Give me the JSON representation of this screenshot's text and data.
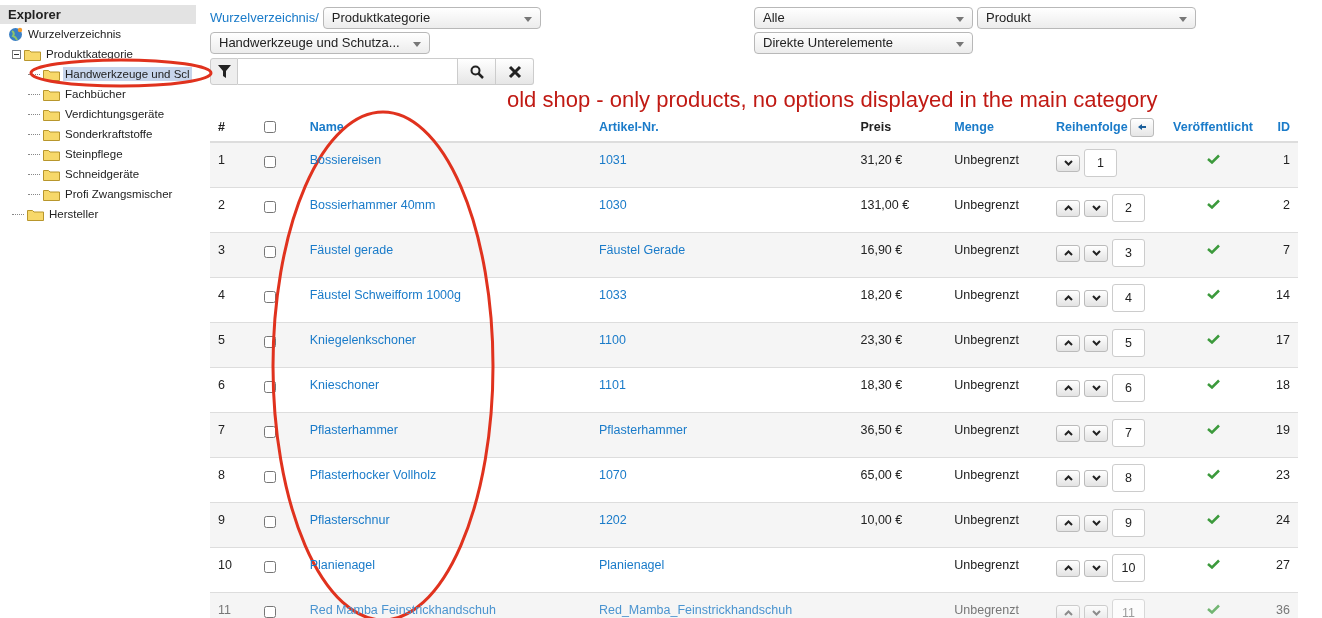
{
  "sidebar": {
    "title": "Explorer",
    "root": {
      "label": "Wurzelverzeichnis",
      "children": [
        {
          "label": "Produktkategorie",
          "expanded": true,
          "selected": false,
          "children": [
            {
              "label": "Handwerkzeuge und Scl",
              "selected": true
            },
            {
              "label": "Fachbücher",
              "selected": false
            },
            {
              "label": "Verdichtungsgeräte",
              "selected": false
            },
            {
              "label": "Sonderkraftstoffe",
              "selected": false
            },
            {
              "label": "Steinpflege",
              "selected": false
            },
            {
              "label": "Schneidgeräte",
              "selected": false
            },
            {
              "label": "Profi Zwangsmischer",
              "selected": false
            }
          ]
        },
        {
          "label": "Hersteller",
          "selected": false
        }
      ]
    }
  },
  "breadcrumb": "Wurzelverzeichnis/",
  "selects_left": [
    "Produktkategorie",
    "Handwerkzeuge und Schutza..."
  ],
  "selects_right": [
    "Alle",
    "Produkt",
    "Direkte Unterelemente"
  ],
  "annotation": "old shop - only products, no options displayed in the main category",
  "table": {
    "columns": [
      {
        "label": "#",
        "kind": "text"
      },
      {
        "kind": "checkbox",
        "checked": false
      },
      {
        "label": "Name",
        "kind": "link"
      },
      {
        "label": "Artikel-Nr.",
        "kind": "link"
      },
      {
        "label": "Preis",
        "kind": "text"
      },
      {
        "label": "Menge",
        "kind": "link"
      },
      {
        "label": "Reihenfolge",
        "kind": "link"
      },
      {
        "label": "Veröffentlicht",
        "kind": "link"
      },
      {
        "label": "ID",
        "kind": "link"
      }
    ],
    "rows": [
      {
        "num": "1",
        "name": "Bossiereisen",
        "sku": "1031",
        "price": "31,20 €",
        "stock": "Unbegrenzt",
        "up": false,
        "down": true,
        "order": "1",
        "published": true,
        "id": "1",
        "faded": false
      },
      {
        "num": "2",
        "name": "Bossierhammer 40mm",
        "sku": "1030",
        "price": "131,00 €",
        "stock": "Unbegrenzt",
        "up": true,
        "down": true,
        "order": "2",
        "published": true,
        "id": "2",
        "faded": false
      },
      {
        "num": "3",
        "name": "Fäustel gerade",
        "sku": "Fäustel Gerade",
        "price": "16,90 €",
        "stock": "Unbegrenzt",
        "up": true,
        "down": true,
        "order": "3",
        "published": true,
        "id": "7",
        "faded": false
      },
      {
        "num": "4",
        "name": "Fäustel Schweifform 1000g",
        "sku": "1033",
        "price": "18,20 €",
        "stock": "Unbegrenzt",
        "up": true,
        "down": true,
        "order": "4",
        "published": true,
        "id": "14",
        "faded": false
      },
      {
        "num": "5",
        "name": "Kniegelenkschoner",
        "sku": "1100",
        "price": "23,30 €",
        "stock": "Unbegrenzt",
        "up": true,
        "down": true,
        "order": "5",
        "published": true,
        "id": "17",
        "faded": false
      },
      {
        "num": "6",
        "name": "Knieschoner",
        "sku": "1101",
        "price": "18,30 €",
        "stock": "Unbegrenzt",
        "up": true,
        "down": true,
        "order": "6",
        "published": true,
        "id": "18",
        "faded": false
      },
      {
        "num": "7",
        "name": "Pflasterhammer",
        "sku": "Pflasterhammer",
        "price": "36,50 €",
        "stock": "Unbegrenzt",
        "up": true,
        "down": true,
        "order": "7",
        "published": true,
        "id": "19",
        "faded": false
      },
      {
        "num": "8",
        "name": "Pflasterhocker Vollholz",
        "sku": "1070",
        "price": "65,00 €",
        "stock": "Unbegrenzt",
        "up": true,
        "down": true,
        "order": "8",
        "published": true,
        "id": "23",
        "faded": false
      },
      {
        "num": "9",
        "name": "Pflasterschnur",
        "sku": "1202",
        "price": "10,00 €",
        "stock": "Unbegrenzt",
        "up": true,
        "down": true,
        "order": "9",
        "published": true,
        "id": "24",
        "faded": false
      },
      {
        "num": "10",
        "name": "Planienagel",
        "sku": "Planienagel",
        "stock": "Unbegrenzt",
        "up": true,
        "down": true,
        "order": "10",
        "published": true,
        "id": "27",
        "faded": false
      },
      {
        "num": "11",
        "name": "Red Mamba Feinstrickhandschuh",
        "sku": "Red_Mamba_Feinstrickhandschuh",
        "stock": "Unbegrenzt",
        "up": true,
        "down": true,
        "order": "11",
        "published": true,
        "id": "36",
        "faded": true
      }
    ]
  }
}
